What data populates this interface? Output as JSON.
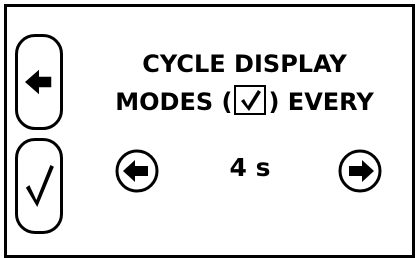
{
  "screen": {
    "title_line1": "CYCLE DISPLAY",
    "title_line2_pre": "MODES (",
    "title_line2_post": ") EVERY"
  },
  "interval": {
    "value": "4 s"
  },
  "icons": {
    "back": "arrow-left-icon",
    "confirm": "checkmark-icon",
    "checkbox": "checkbox-checked-icon",
    "decrease": "circle-arrow-left-icon",
    "increase": "circle-arrow-right-icon"
  },
  "colors": {
    "foreground": "#000000",
    "background": "#ffffff"
  }
}
